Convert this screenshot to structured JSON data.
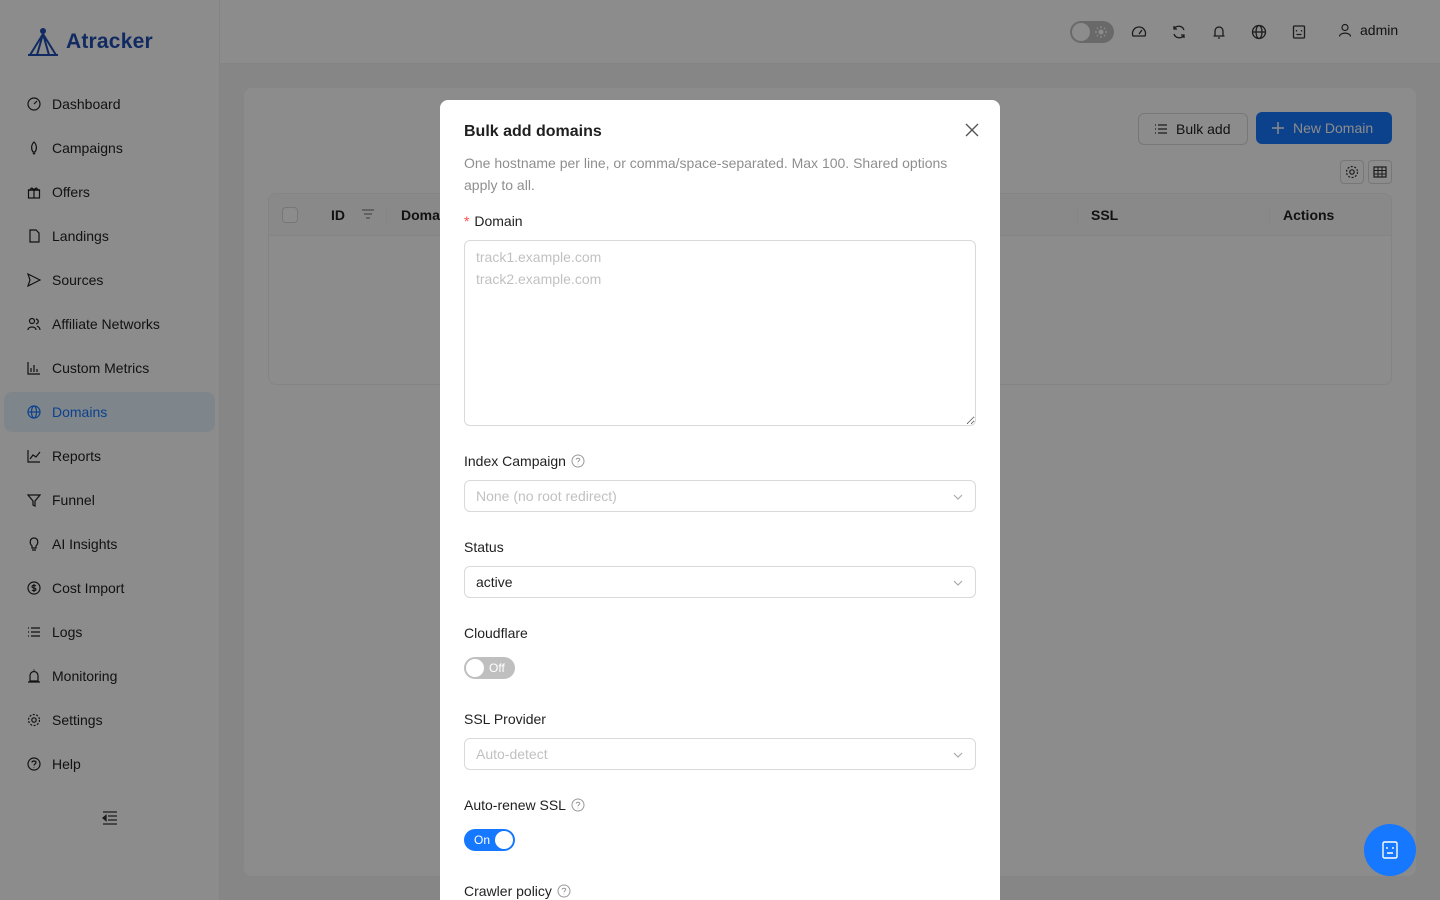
{
  "app": {
    "name": "Atracker"
  },
  "sidebar": {
    "items": [
      {
        "label": "Dashboard",
        "icon": "dashboard-icon"
      },
      {
        "label": "Campaigns",
        "icon": "rocket-icon"
      },
      {
        "label": "Offers",
        "icon": "gift-icon"
      },
      {
        "label": "Landings",
        "icon": "file-icon"
      },
      {
        "label": "Sources",
        "icon": "send-icon"
      },
      {
        "label": "Affiliate Networks",
        "icon": "team-icon"
      },
      {
        "label": "Custom Metrics",
        "icon": "bar-chart-icon"
      },
      {
        "label": "Domains",
        "icon": "globe-icon",
        "active": true
      },
      {
        "label": "Reports",
        "icon": "line-chart-icon"
      },
      {
        "label": "Funnel",
        "icon": "funnel-icon"
      },
      {
        "label": "AI Insights",
        "icon": "bulb-icon"
      },
      {
        "label": "Cost Import",
        "icon": "dollar-icon"
      },
      {
        "label": "Logs",
        "icon": "list-icon"
      },
      {
        "label": "Monitoring",
        "icon": "alert-icon"
      },
      {
        "label": "Settings",
        "icon": "gear-icon"
      },
      {
        "label": "Help",
        "icon": "question-icon"
      }
    ]
  },
  "header": {
    "user": "admin"
  },
  "toolbar": {
    "bulk_add": "Bulk add",
    "new_domain": "New Domain"
  },
  "table": {
    "columns": [
      "ID",
      "Doma",
      "SSL",
      "Actions"
    ]
  },
  "modal": {
    "title": "Bulk add domains",
    "description": "One hostname per line, or comma/space-separated. Max 100. Shared options apply to all.",
    "domain_label": "Domain",
    "domain_placeholder": "track1.example.com\ntrack2.example.com",
    "index_campaign_label": "Index Campaign",
    "index_campaign_placeholder": "None (no root redirect)",
    "status_label": "Status",
    "status_value": "active",
    "cloudflare_label": "Cloudflare",
    "cloudflare_toggle": "Off",
    "ssl_provider_label": "SSL Provider",
    "ssl_provider_placeholder": "Auto-detect",
    "auto_renew_label": "Auto-renew SSL",
    "auto_renew_toggle": "On",
    "crawler_label": "Crawler policy"
  },
  "colors": {
    "primary": "#1677ff",
    "brand": "#1f4fb3"
  }
}
